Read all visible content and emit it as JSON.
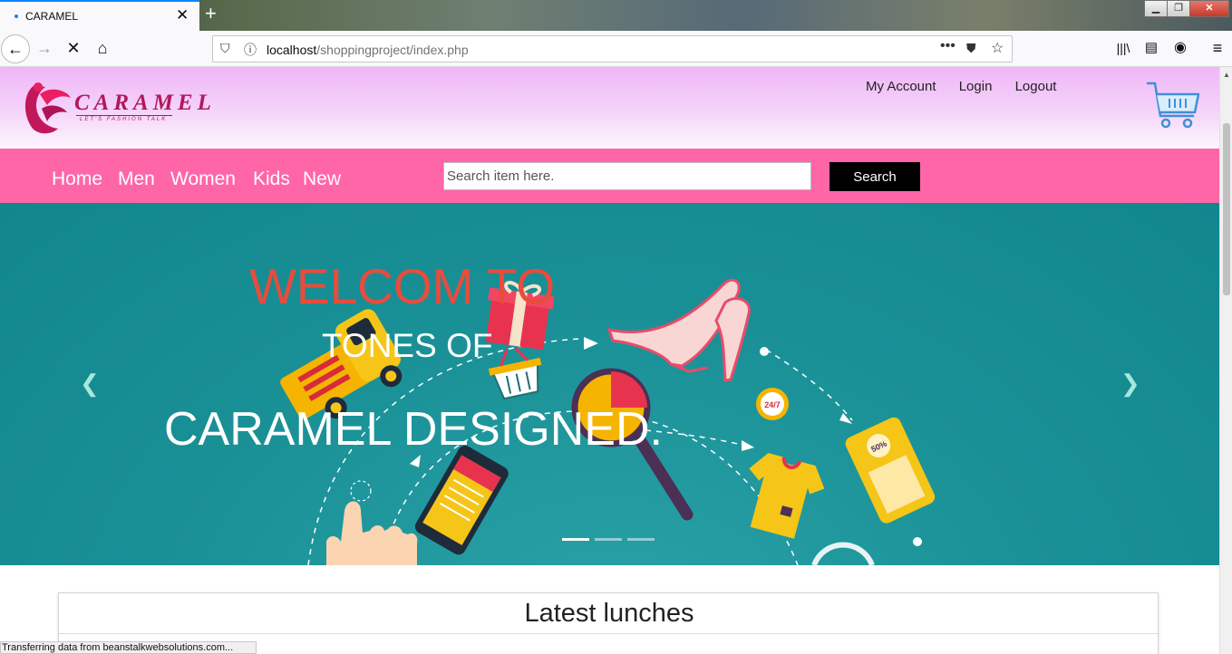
{
  "browser": {
    "tab_title": "CARAMEL",
    "url_host": "localhost",
    "url_path": "/shoppingproject/index.php",
    "status_text": "Transferring data from beanstalkwebsolutions.com..."
  },
  "header": {
    "logo_text": "CARAMEL",
    "logo_tagline": "LET'S FASHION TALK",
    "links": [
      "My Account",
      "Login",
      "Logout"
    ]
  },
  "menu": {
    "items": [
      "Home",
      "Men",
      "Women",
      "Kids",
      "New"
    ],
    "search_placeholder": "Search item here.",
    "search_button": "Search"
  },
  "carousel": {
    "line1": "WELCOM TO",
    "line2": "TONES OF",
    "line3": "CARAMEL DESIGNED.",
    "active_index": 0,
    "slide_count": 3
  },
  "section": {
    "title": "Latest lunches"
  },
  "colors": {
    "menu_bg": "#ff66a8",
    "slider_bg": "#1a9197",
    "welcome": "#e84c3d",
    "brand": "#b0185d"
  }
}
